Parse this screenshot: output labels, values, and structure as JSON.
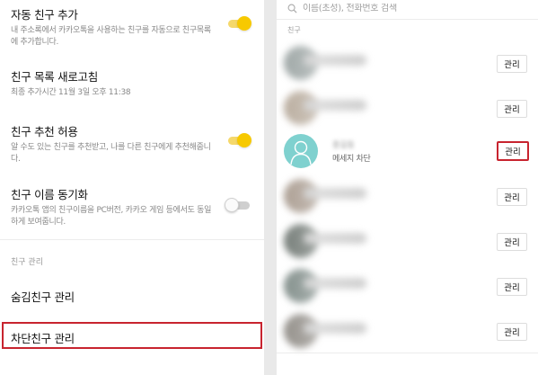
{
  "settings": {
    "auto_add": {
      "title": "자동 친구 추가",
      "desc": "내 주소록에서 카카오톡을 사용하는 친구를 자동으로 친구목록에 추가합니다.",
      "enabled": true
    },
    "refresh": {
      "title": "친구 목록 새로고침",
      "desc": "최종 추가시간 11월 3일 오후 11:38"
    },
    "recommend": {
      "title": "친구 추천 허용",
      "desc": "알 수도 있는 친구를 추천받고, 나를 다른 친구에게 추천해줍니다.",
      "enabled": true
    },
    "name_sync": {
      "title": "친구 이름 동기화",
      "desc": "카카오톡 앱의 친구이름을 PC버전, 카카오 게임 등에서도 동일하게 보여줍니다.",
      "enabled": false
    }
  },
  "manage": {
    "section_label": "친구 관리",
    "hidden": "숨김친구 관리",
    "blocked": "차단친구 관리"
  },
  "right": {
    "search_placeholder": "이름(초성), 전화번호 검색",
    "section_label": "친구",
    "manage_label": "관리",
    "blocked_friend": {
      "name": "홍길동",
      "status": "메세지 차단"
    }
  },
  "colors": {
    "accent": "#f7c900",
    "highlight": "#c8242f",
    "default_avatar": "#7fd1cf"
  }
}
